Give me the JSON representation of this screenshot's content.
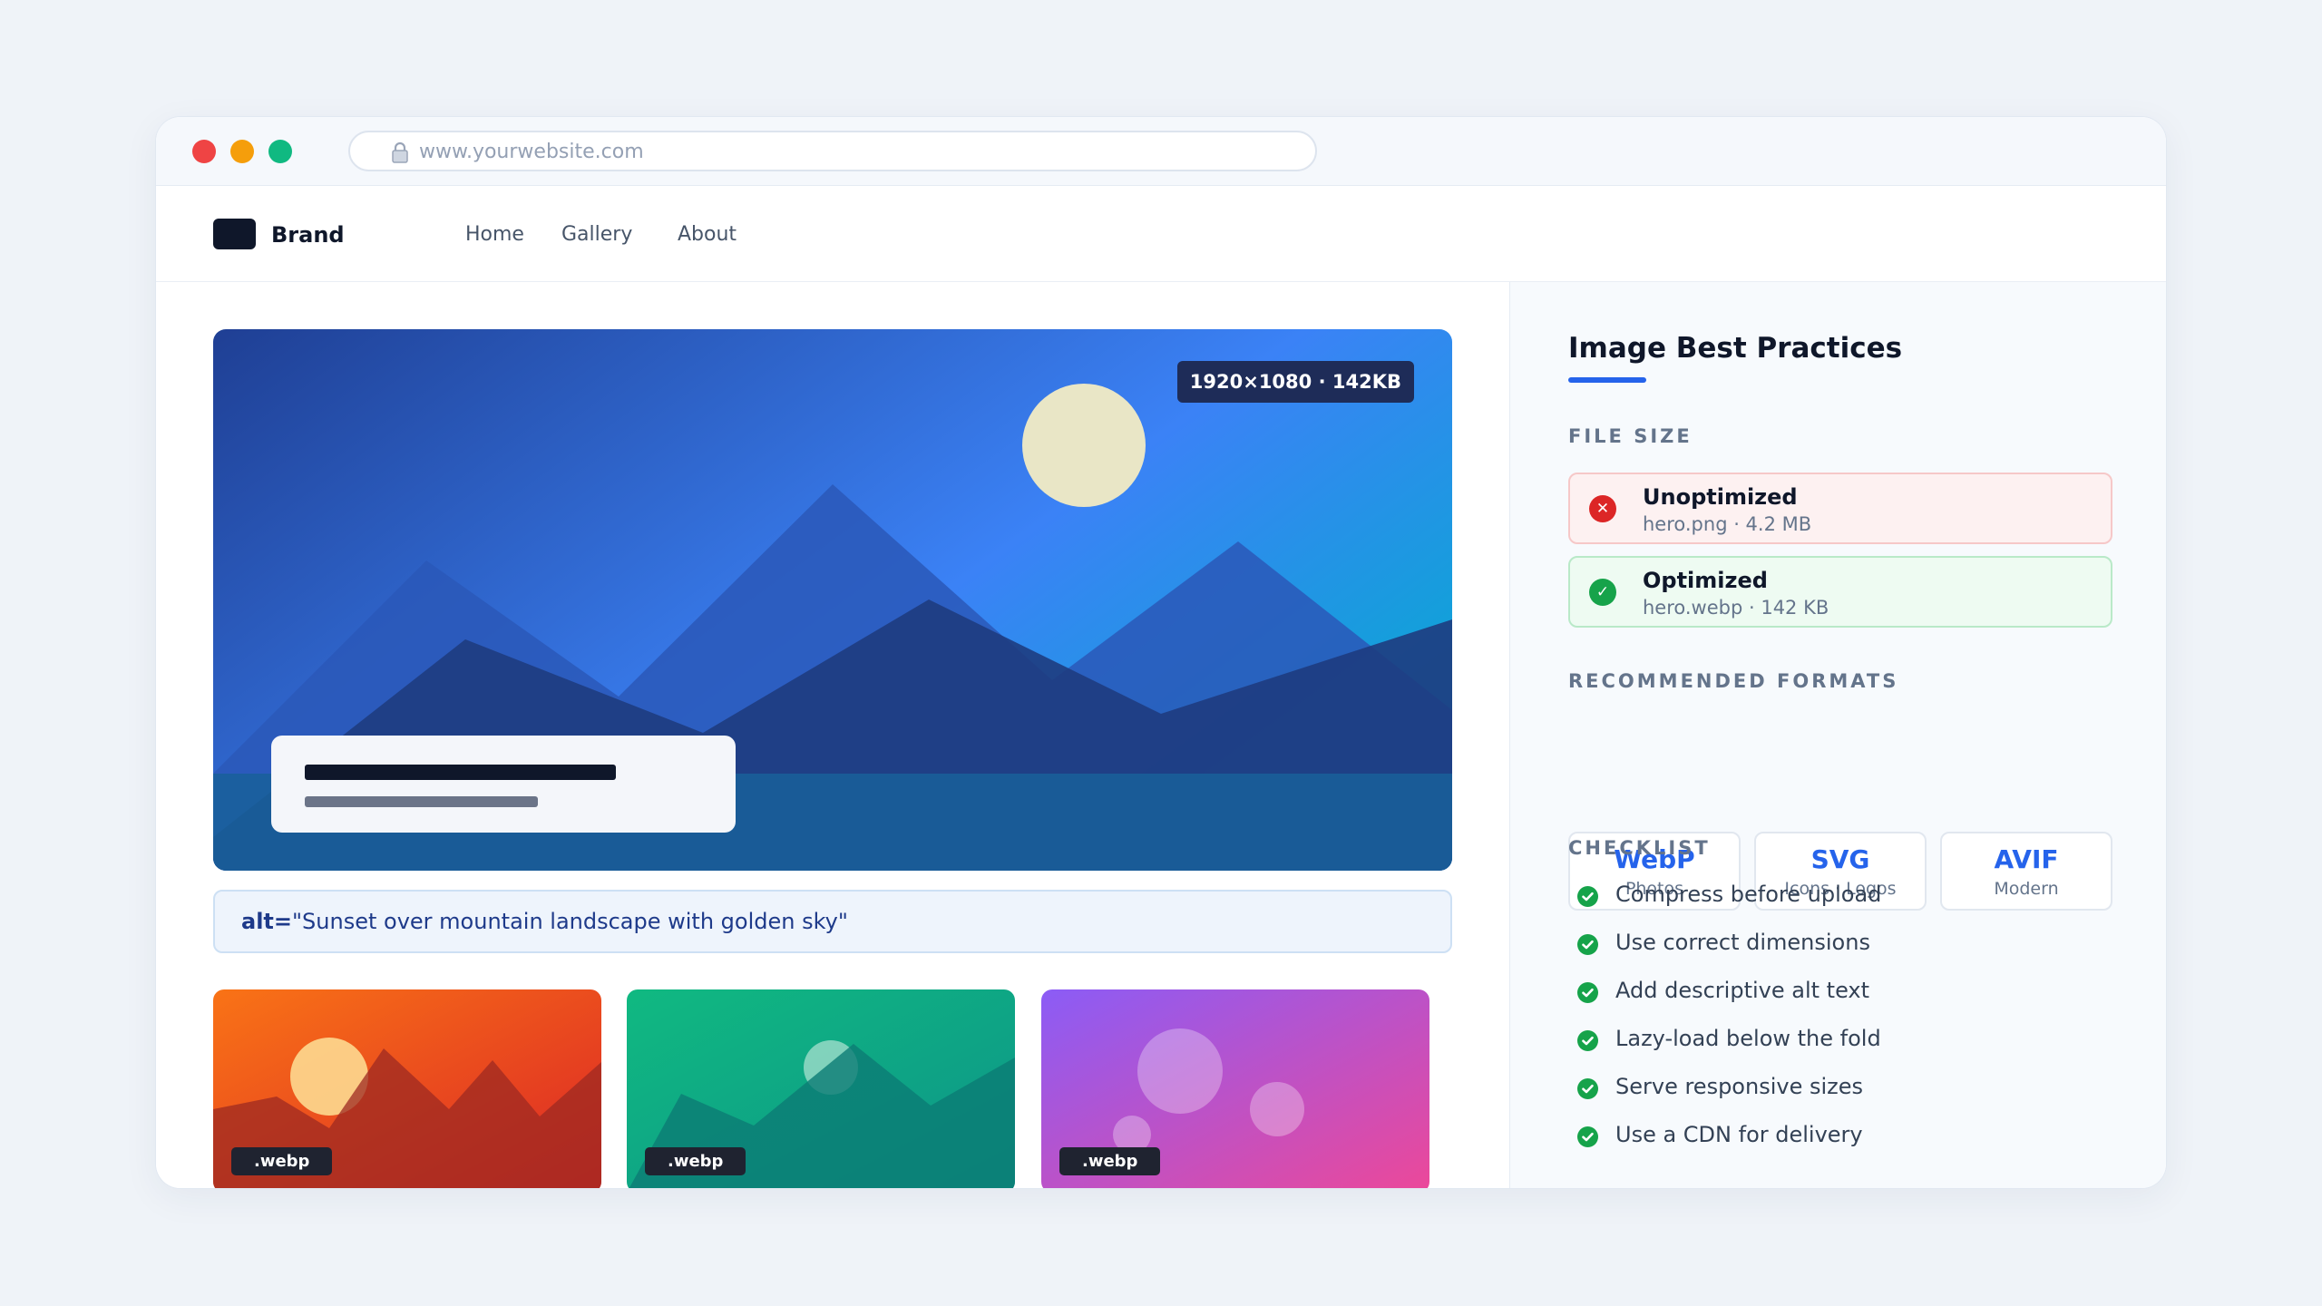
{
  "browser": {
    "url": "www.yourwebsite.com",
    "controls": [
      "close",
      "minimize",
      "maximize"
    ]
  },
  "nav": {
    "brand": "Brand",
    "links": [
      "Home",
      "Gallery",
      "About"
    ]
  },
  "hero": {
    "dimensions_badge": "1920×1080 · 142KB",
    "alt_attr": "alt=",
    "alt_value": "\"Sunset over mountain landscape with golden sky\""
  },
  "thumbnails": [
    {
      "format": ".webp",
      "theme": "sunset"
    },
    {
      "format": ".webp",
      "theme": "teal-mountains"
    },
    {
      "format": ".webp",
      "theme": "purple-bubbles"
    }
  ],
  "sidebar": {
    "title": "Image Best Practices",
    "file_size": {
      "label": "FILE SIZE",
      "unoptimized": {
        "title": "Unoptimized",
        "detail": "hero.png · 4.2 MB",
        "icon": "x-icon"
      },
      "optimized": {
        "title": "Optimized",
        "detail": "hero.webp · 142 KB",
        "icon": "check-icon"
      }
    },
    "formats": {
      "label": "RECOMMENDED FORMATS",
      "items": [
        {
          "name": "WebP",
          "use": "Photos"
        },
        {
          "name": "SVG",
          "use": "Icons · Logos"
        },
        {
          "name": "AVIF",
          "use": "Modern"
        }
      ]
    },
    "checklist": {
      "label": "CHECKLIST",
      "items": [
        "Compress before upload",
        "Use correct dimensions",
        "Add descriptive alt text",
        "Lazy-load below the fold",
        "Serve responsive sizes",
        "Use a CDN for delivery"
      ]
    }
  },
  "colors": {
    "accent": "#2563eb",
    "success": "#16a34a",
    "danger": "#dc2626"
  }
}
